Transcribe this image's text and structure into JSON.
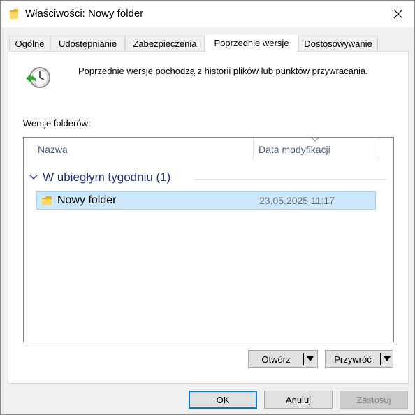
{
  "window": {
    "title": "Właściwości: Nowy folder"
  },
  "tabs": [
    {
      "label": "Ogólne",
      "active": false
    },
    {
      "label": "Udostępnianie",
      "active": false
    },
    {
      "label": "Zabezpieczenia",
      "active": false
    },
    {
      "label": "Poprzednie wersje",
      "active": true
    },
    {
      "label": "Dostosowywanie",
      "active": false
    }
  ],
  "panel": {
    "info_text": "Poprzednie wersje pochodzą z historii plików lub punktów przywracania.",
    "versions_label": "Wersje folderów:",
    "columns": {
      "name": "Nazwa",
      "date": "Data modyfikacji"
    },
    "group": {
      "title": "W ubiegłym tygodniu (1)"
    },
    "rows": [
      {
        "name": "Nowy folder",
        "date": "23.05.2025 11:17",
        "selected": true
      }
    ],
    "open_button": "Otwórz",
    "restore_button": "Przywróć"
  },
  "footer": {
    "ok": "OK",
    "cancel": "Anuluj",
    "apply": "Zastosuj"
  },
  "colors": {
    "selection": "#cce8ff",
    "group_header": "#1e3287",
    "default_button_border": "#0078d7"
  },
  "icons": {
    "title": "folder-icon",
    "close": "close-icon",
    "header": "clock-restore-icon",
    "row": "folder-icon"
  }
}
